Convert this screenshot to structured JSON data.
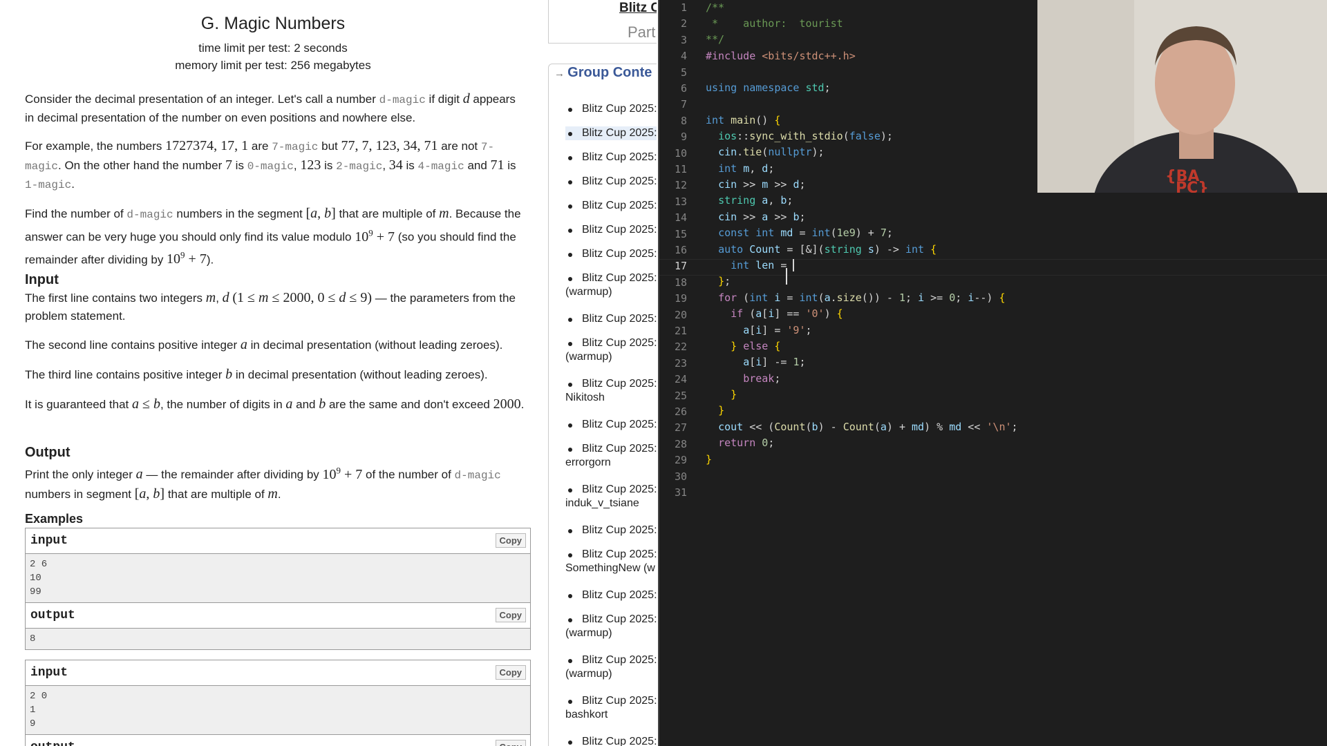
{
  "problem": {
    "title": "G. Magic Numbers",
    "time_limit": "time limit per test: 2 seconds",
    "memory_limit": "memory limit per test: 256 megabytes",
    "input_heading": "Input",
    "output_heading": "Output",
    "examples_heading": "Examples",
    "examples": [
      {
        "input_label": "input",
        "input": "2 6\n10\n99",
        "output_label": "output",
        "output": "8",
        "copy": "Copy"
      },
      {
        "input_label": "input",
        "input": "2 0\n1\n9",
        "output_label": "output",
        "copy": "Copy"
      }
    ]
  },
  "sidebar": {
    "top_title": "Blitz C",
    "participation": "Part",
    "group_heading": "Group Conte",
    "items": [
      {
        "label": "Blitz Cup 2025:",
        "sub": ""
      },
      {
        "label": "Blitz Cup 2025:",
        "sub": "",
        "selected": true
      },
      {
        "label": "Blitz Cup 2025:",
        "sub": ""
      },
      {
        "label": "Blitz Cup 2025:",
        "sub": ""
      },
      {
        "label": "Blitz Cup 2025:",
        "sub": ""
      },
      {
        "label": "Blitz Cup 2025:",
        "sub": ""
      },
      {
        "label": "Blitz Cup 2025:",
        "sub": ""
      },
      {
        "label": "Blitz Cup 2025:",
        "sub": "(warmup)"
      },
      {
        "label": "Blitz Cup 2025:",
        "sub": ""
      },
      {
        "label": "Blitz Cup 2025:",
        "sub": "(warmup)"
      },
      {
        "label": "Blitz Cup 2025:",
        "sub": "Nikitosh"
      },
      {
        "label": "Blitz Cup 2025:",
        "sub": ""
      },
      {
        "label": "Blitz Cup 2025:",
        "sub": "errorgorn"
      },
      {
        "label": "Blitz Cup 2025:",
        "sub": "induk_v_tsiane"
      },
      {
        "label": "Blitz Cup 2025:",
        "sub": ""
      },
      {
        "label": "Blitz Cup 2025:",
        "sub": "SomethingNew (w"
      },
      {
        "label": "Blitz Cup 2025:",
        "sub": ""
      },
      {
        "label": "Blitz Cup 2025:",
        "sub": "(warmup)"
      },
      {
        "label": "Blitz Cup 2025:",
        "sub": "(warmup)"
      },
      {
        "label": "Blitz Cup 2025:",
        "sub": "bashkort"
      },
      {
        "label": "Blitz Cup 2025:",
        "sub": ""
      }
    ]
  },
  "editor": {
    "current_line": 17,
    "line_numbers": [
      "1",
      "2",
      "3",
      "4",
      "5",
      "6",
      "7",
      "8",
      "9",
      "10",
      "11",
      "12",
      "13",
      "14",
      "15",
      "16",
      "17",
      "18",
      "19",
      "20",
      "21",
      "22",
      "23",
      "24",
      "25",
      "26",
      "27",
      "28",
      "29",
      "30",
      "31"
    ]
  }
}
